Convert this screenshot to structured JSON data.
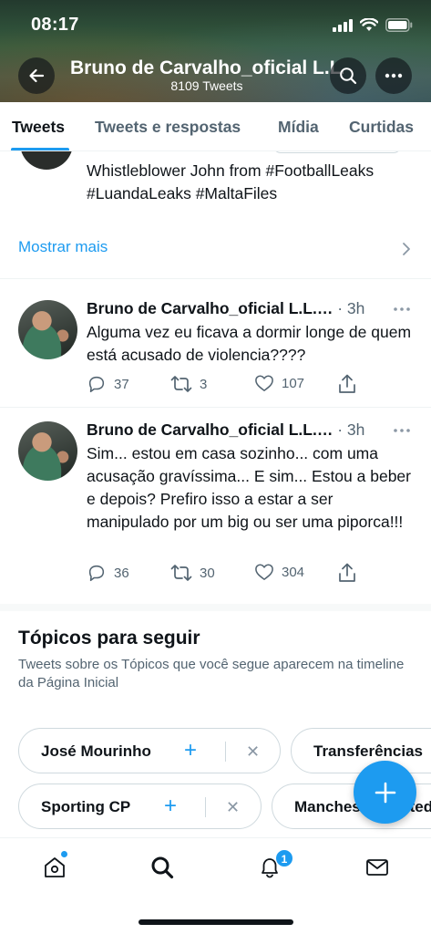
{
  "status_bar": {
    "time": "08:17"
  },
  "header": {
    "title": "Bruno de Carvalho_oficial L.L.",
    "tweet_count": "8109 Tweets"
  },
  "tabs": [
    {
      "label": "Tweets",
      "active": true
    },
    {
      "label": "Tweets e respostas",
      "active": false
    },
    {
      "label": "Mídia",
      "active": false
    },
    {
      "label": "Curtidas",
      "active": false
    }
  ],
  "bio": {
    "text": "Whistleblower John from #FootballLeaks #LuandaLeaks #MaltaFiles",
    "show_more": "Mostrar mais"
  },
  "tweets": [
    {
      "name": "Bruno de Carvalho_oficial L.L.…",
      "time": "3h",
      "text": "Alguma vez eu ficava a dormir longe de quem está acusado de violencia????",
      "replies": "37",
      "retweets": "3",
      "likes": "107"
    },
    {
      "name": "Bruno de Carvalho_oficial L.L.…",
      "time": "3h",
      "text": "Sim... estou em casa sozinho... com uma acusação gravíssima... E sim... Estou a beber e depois? Prefiro isso a estar a ser manipulado por um big ou ser uma piporca!!!",
      "replies": "36",
      "retweets": "30",
      "likes": "304"
    }
  ],
  "topics": {
    "title": "Tópicos para seguir",
    "subtitle": "Tweets sobre os Tópicos que você segue aparecem na timeline da Página Inicial",
    "chips_row1": [
      "José Mourinho",
      "Transferências"
    ],
    "chips_row2": [
      "Sporting CP",
      "Manchester United"
    ]
  },
  "nav": {
    "notifications_badge": "1"
  },
  "colors": {
    "accent": "#1d9bf0",
    "text_primary": "#0f1419",
    "text_secondary": "#536471"
  },
  "icons": {
    "header": [
      "back-arrow-icon",
      "search-icon",
      "more-icon"
    ],
    "tweet_actions": [
      "reply-icon",
      "retweet-icon",
      "like-icon",
      "share-icon"
    ],
    "nav": [
      "home-icon",
      "explore-search-icon",
      "notifications-bell-icon",
      "messages-mail-icon"
    ],
    "fab": "compose-plus-icon"
  }
}
